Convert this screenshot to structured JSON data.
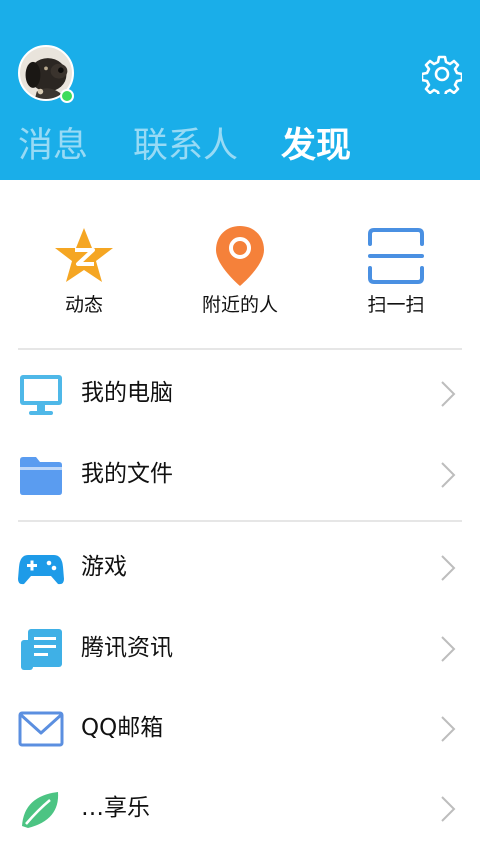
{
  "tabs": [
    "消息",
    "联系人",
    "发现"
  ],
  "active_tab": "发现",
  "quick_actions": [
    {
      "label": "动态",
      "icon": "qzone-star-icon"
    },
    {
      "label": "附近的人",
      "icon": "location-pin-icon"
    },
    {
      "label": "扫一扫",
      "icon": "scan-icon"
    }
  ],
  "menu": [
    {
      "label": "我的电脑",
      "icon": "computer-icon"
    },
    {
      "label": "我的文件",
      "icon": "folder-icon"
    },
    {
      "label": "游戏",
      "icon": "gamepad-icon"
    },
    {
      "label": "腾讯资讯",
      "icon": "news-icon"
    },
    {
      "label": "QQ邮箱",
      "icon": "mail-icon"
    },
    {
      "label": "…享乐",
      "icon": "leaf-icon"
    }
  ],
  "colors": {
    "header": "#1aaee9",
    "online": "#3ddc5b",
    "qzone": "#f5a623",
    "location": "#f5813a",
    "scan": "#4a90e2"
  }
}
